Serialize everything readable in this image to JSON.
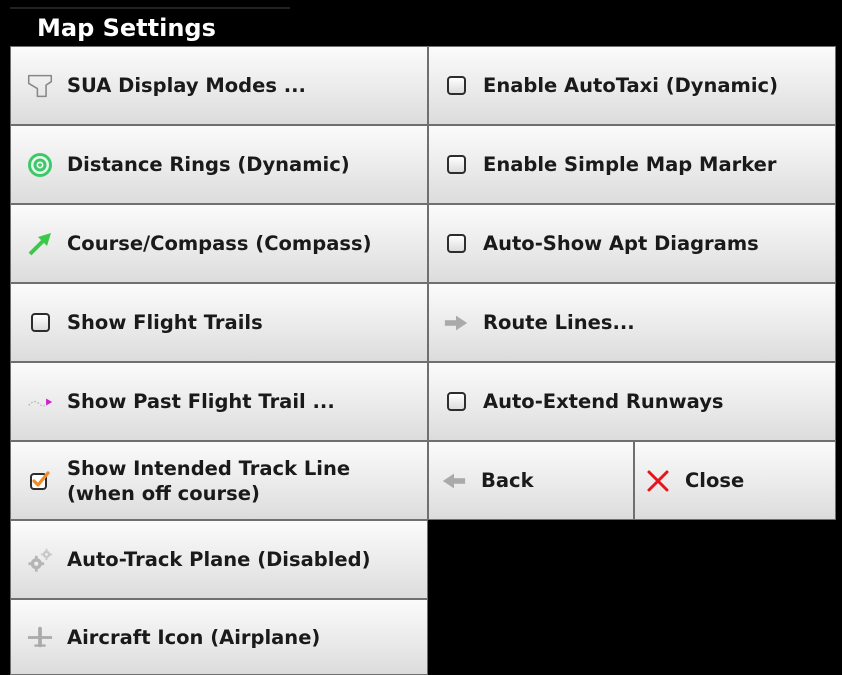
{
  "title": "Map Settings",
  "left_items": [
    {
      "label": "SUA Display Modes ...",
      "icon": "sua-icon"
    },
    {
      "label": "Distance Rings (Dynamic)",
      "icon": "target-rings-icon"
    },
    {
      "label": "Course/Compass (Compass)",
      "icon": "green-arrow-icon"
    },
    {
      "label": "Show Flight Trails",
      "icon": "checkbox-unchecked",
      "checked": false
    },
    {
      "label": "Show Past Flight Trail ...",
      "icon": "trail-icon"
    },
    {
      "label_line1": "Show Intended Track Line",
      "label_line2": "(when off course)",
      "icon": "checkbox-checked",
      "checked": true
    },
    {
      "label": "Auto-Track Plane (Disabled)",
      "icon": "gears-icon"
    },
    {
      "label": "Aircraft Icon (Airplane)",
      "icon": "airplane-icon"
    }
  ],
  "right_items": [
    {
      "label": "Enable AutoTaxi (Dynamic)",
      "icon": "checkbox-unchecked",
      "checked": false
    },
    {
      "label": "Enable Simple Map Marker",
      "icon": "checkbox-unchecked",
      "checked": false
    },
    {
      "label": "Auto-Show Apt Diagrams",
      "icon": "checkbox-unchecked",
      "checked": false
    },
    {
      "label": "Route Lines...",
      "icon": "right-arrow-icon"
    },
    {
      "label": "Auto-Extend Runways",
      "icon": "checkbox-unchecked",
      "checked": false
    }
  ],
  "back_label": "Back",
  "close_label": "Close",
  "colors": {
    "accent_green": "#2ecc40",
    "check_orange": "#f28c28",
    "close_red": "#e8141b"
  }
}
